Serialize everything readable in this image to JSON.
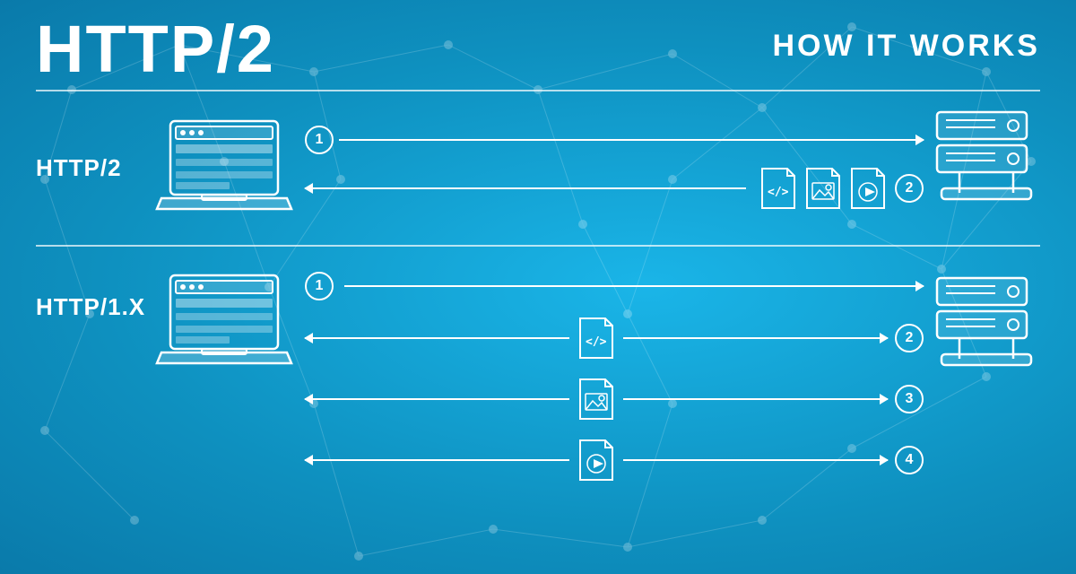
{
  "header": {
    "main_title": "HTTP/2",
    "subtitle": "HOW IT WORKS"
  },
  "sections": {
    "http2": {
      "label": "HTTP/2",
      "request_num": "1",
      "response_num": "2",
      "files": [
        "code-file",
        "image-file",
        "video-file"
      ]
    },
    "http1": {
      "label": "HTTP/1.X",
      "request_num": "1",
      "response_nums": [
        "2",
        "3",
        "4"
      ],
      "files": [
        "code-file",
        "image-file",
        "video-file"
      ]
    }
  },
  "colors": {
    "bg": "#18a8d8",
    "white": "#ffffff",
    "accent": "#1ab5e8"
  }
}
